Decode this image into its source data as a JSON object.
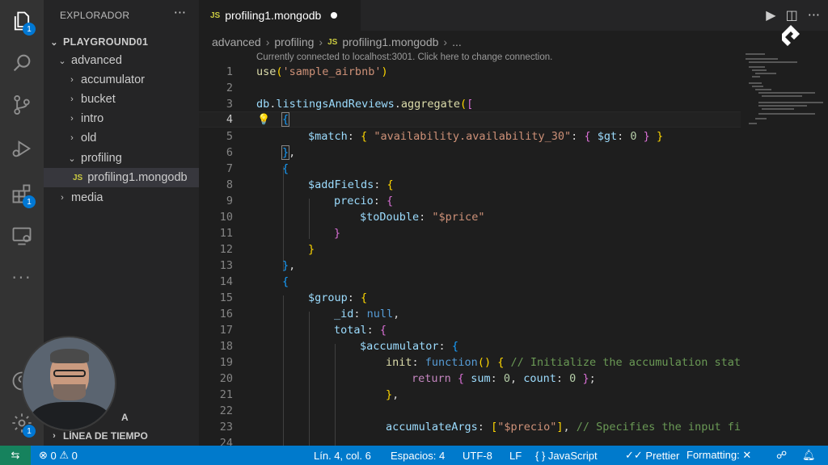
{
  "colors": {
    "accent": "#007acc",
    "remote": "#16825d",
    "badge": "#0078d4"
  },
  "activity_bar": {
    "items": [
      {
        "icon": "files-icon",
        "badge": "1"
      },
      {
        "icon": "search-icon",
        "badge": ""
      },
      {
        "icon": "source-control-icon",
        "badge": ""
      },
      {
        "icon": "run-debug-icon",
        "badge": ""
      },
      {
        "icon": "extensions-icon",
        "badge": "1"
      },
      {
        "icon": "remote-explorer-icon",
        "badge": ""
      },
      {
        "icon": "more-icon",
        "badge": ""
      },
      {
        "icon": "account-icon",
        "badge": ""
      },
      {
        "icon": "settings-gear-icon",
        "badge": "1"
      }
    ]
  },
  "sidebar": {
    "header": "EXPLORADOR",
    "more": "···",
    "workspace": "PLAYGROUND01",
    "tree": [
      {
        "label": "advanced",
        "depth": 1,
        "type": "folder-open"
      },
      {
        "label": "accumulator",
        "depth": 2,
        "type": "folder"
      },
      {
        "label": "bucket",
        "depth": 2,
        "type": "folder"
      },
      {
        "label": "intro",
        "depth": 2,
        "type": "folder"
      },
      {
        "label": "old",
        "depth": 2,
        "type": "folder"
      },
      {
        "label": "profiling",
        "depth": 2,
        "type": "folder-open"
      },
      {
        "label": "profiling1.mongodb",
        "depth": 3,
        "type": "file",
        "tag": "JS",
        "selected": true
      },
      {
        "label": "media",
        "depth": 1,
        "type": "folder"
      }
    ],
    "outline_section": "ESQUEMA",
    "outline_partial": "A",
    "timeline_section": "LÍNEA DE TIEMPO"
  },
  "tab": {
    "tag": "JS",
    "label": "profiling1.mongodb"
  },
  "breadcrumb": {
    "parts": [
      "advanced",
      "profiling"
    ],
    "file_tag": "JS",
    "file": "profiling1.mongodb",
    "tail": "..."
  },
  "editor": {
    "codelens": "Currently connected to localhost:3001. Click here to change connection.",
    "active_line": 4
  },
  "status": {
    "errors": "0",
    "warnings": "0",
    "position": "Lín. 4, col. 6",
    "spaces": "Espacios: 4",
    "encoding": "UTF-8",
    "eol": "LF",
    "language_braces": "{ }",
    "language": "JavaScript",
    "prettier": "Prettier",
    "formatting": "Formatting: ✕"
  }
}
